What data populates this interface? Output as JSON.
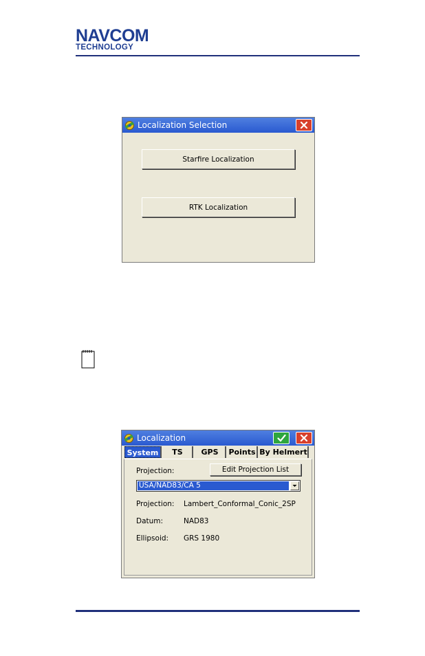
{
  "logo": {
    "line1": "NAVCOM",
    "line2": "TECHNOLOGY"
  },
  "colors": {
    "brand": "#1f3e92",
    "titlebar": "#2a5ad0",
    "dialog_bg": "#ebe8d8",
    "close": "#d8402c",
    "ok": "#2ea63e"
  },
  "dialog1": {
    "title": "Localization Selection",
    "title_icon": "satellite-app-icon",
    "close_icon": "close-icon",
    "buttons": [
      "Starfire Localization",
      "RTK Localization"
    ]
  },
  "note": {
    "icon": "note-pad-icon"
  },
  "dialog2": {
    "title": "Localization",
    "title_icon": "satellite-app-icon",
    "ok_icon": "check-icon",
    "close_icon": "close-icon",
    "tabs": [
      "System",
      "TS",
      "GPS",
      "Points",
      "By Helmert"
    ],
    "selected_tab": "System",
    "projection_label": "Projection:",
    "edit_button": "Edit Projection List",
    "selected_projection": "USA/NAD83/CA 5",
    "fields": [
      {
        "label": "Projection:",
        "value": "Lambert_Conformal_Conic_2SP"
      },
      {
        "label": "Datum:",
        "value": "NAD83"
      },
      {
        "label": "Ellipsoid:",
        "value": "GRS 1980"
      }
    ]
  }
}
